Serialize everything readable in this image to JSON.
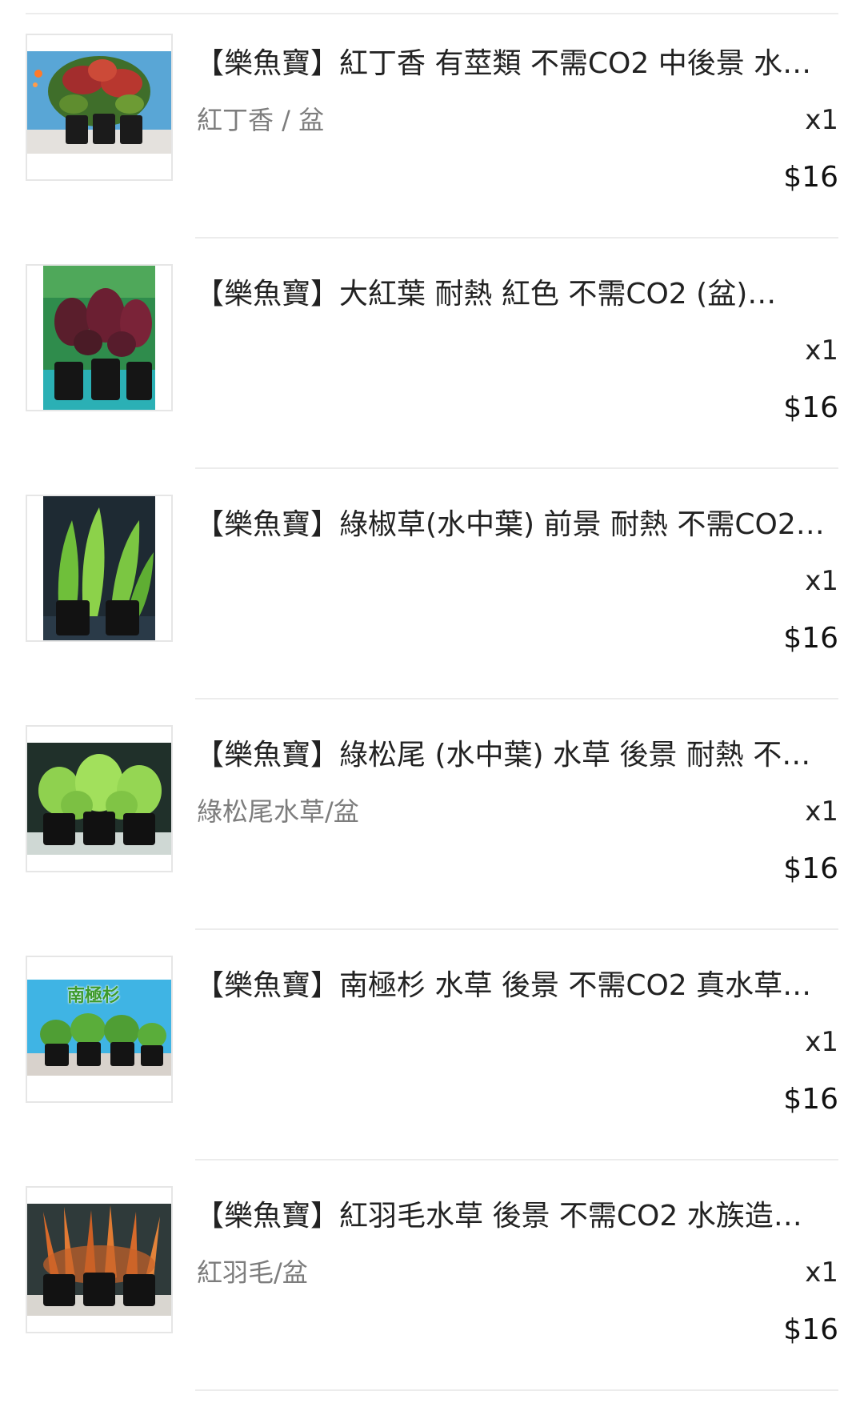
{
  "order_items": [
    {
      "title": "【樂魚寶】紅丁香 有莖類 不需CO2 中後景 水…",
      "variant": "紅丁香 / 盆",
      "quantity": "x1",
      "price": "$16",
      "image_icon": "red-stem-aquarium-plant-photo"
    },
    {
      "title": "【樂魚寶】大紅葉 耐熱 紅色 不需CO2 (盆)…",
      "variant": "",
      "quantity": "x1",
      "price": "$16",
      "image_icon": "dark-red-leaf-plant-photo"
    },
    {
      "title": "【樂魚寶】綠椒草(水中葉) 前景 耐熱 不需CO2…",
      "variant": "",
      "quantity": "x1",
      "price": "$16",
      "image_icon": "green-cryptocoryne-plant-photo"
    },
    {
      "title": "【樂魚寶】綠松尾 (水中葉) 水草 後景 耐熱 不…",
      "variant": "綠松尾水草/盆",
      "quantity": "x1",
      "price": "$16",
      "image_icon": "green-pine-tail-plant-photo"
    },
    {
      "title": "【樂魚寶】南極杉 水草 後景 不需CO2 真水草…",
      "variant": "",
      "quantity": "x1",
      "price": "$16",
      "image_icon": "limnophila-plant-photo",
      "image_caption": "南極杉"
    },
    {
      "title": "【樂魚寶】紅羽毛水草 後景 不需CO2 水族造…",
      "variant": "紅羽毛/盆",
      "quantity": "x1",
      "price": "$16",
      "image_icon": "red-feather-plant-photo"
    }
  ],
  "colors": {
    "text_primary": "#222222",
    "text_secondary": "#7d7d7d",
    "divider": "#ececec"
  }
}
